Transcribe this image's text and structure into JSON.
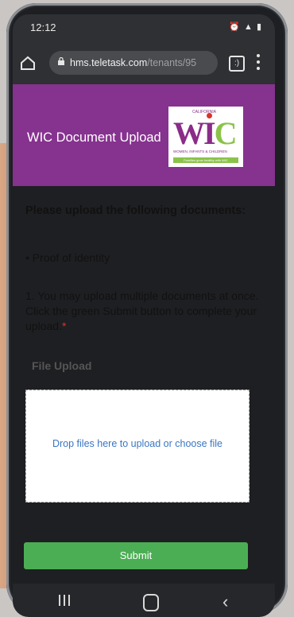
{
  "status_bar": {
    "time": "12:12",
    "icons_left": [
      "voicemail-icon",
      "usb-icon"
    ],
    "icons_right": [
      "alarm-icon",
      "mute-icon",
      "nfc-icon",
      "wifi-icon",
      "signal-icon",
      "battery-icon"
    ]
  },
  "browser": {
    "url_domain": "hms.teletask.com",
    "url_path": "/tenants/95",
    "tab_count": ":)"
  },
  "page": {
    "header_title": "WIC Document Upload",
    "logo": {
      "state": "CALIFORNIA",
      "wordmark": "WIC",
      "subtitle": "WOMEN, INFANTS & CHILDREN",
      "tagline": "Families grow healthy with WIC",
      "accent_colors": [
        "#8a2c88",
        "#8bc34a",
        "#d9342b"
      ]
    },
    "instructions": {
      "heading": "Please upload the following documents:",
      "bullet": "• Proof of identity",
      "note": "1. You may upload multiple documents at once. Click the green Submit button to complete your upload.",
      "required_marker": "*"
    },
    "file_upload": {
      "label": "File Upload",
      "drop_text": "Drop files here to upload or choose file"
    },
    "submit_label": "Submit",
    "colors": {
      "header_bg": "#86328f",
      "submit_bg": "#4cae54",
      "link": "#3a76c4"
    }
  },
  "nav": {
    "buttons": [
      "recents",
      "home",
      "back"
    ]
  }
}
